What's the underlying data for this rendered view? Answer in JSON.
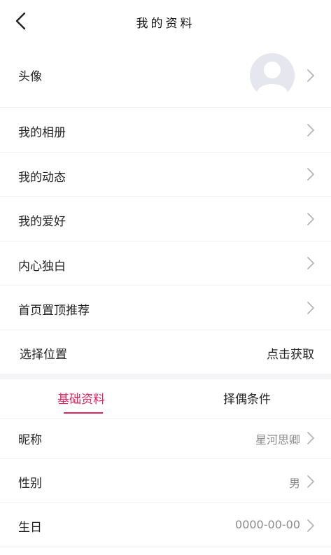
{
  "header": {
    "title": "我的资料",
    "back_icon": "chevron-left-icon"
  },
  "profile_rows": {
    "avatar_label": "头像",
    "album": "我的相册",
    "moments": "我的动态",
    "hobbies": "我的爱好",
    "monologue": "内心独白",
    "homepage_top": "首页置顶推荐",
    "location_label": "选择位置",
    "location_action": "点击获取"
  },
  "tabs": {
    "basic": "基础资料",
    "partner": "择偶条件",
    "active": "basic",
    "accent": "#e0245e"
  },
  "basic_info": {
    "nickname_label": "昵称",
    "nickname_value": "星河思卿",
    "gender_label": "性别",
    "gender_value": "男",
    "birthday_label": "生日",
    "birthday_value": "0000-00-00"
  }
}
